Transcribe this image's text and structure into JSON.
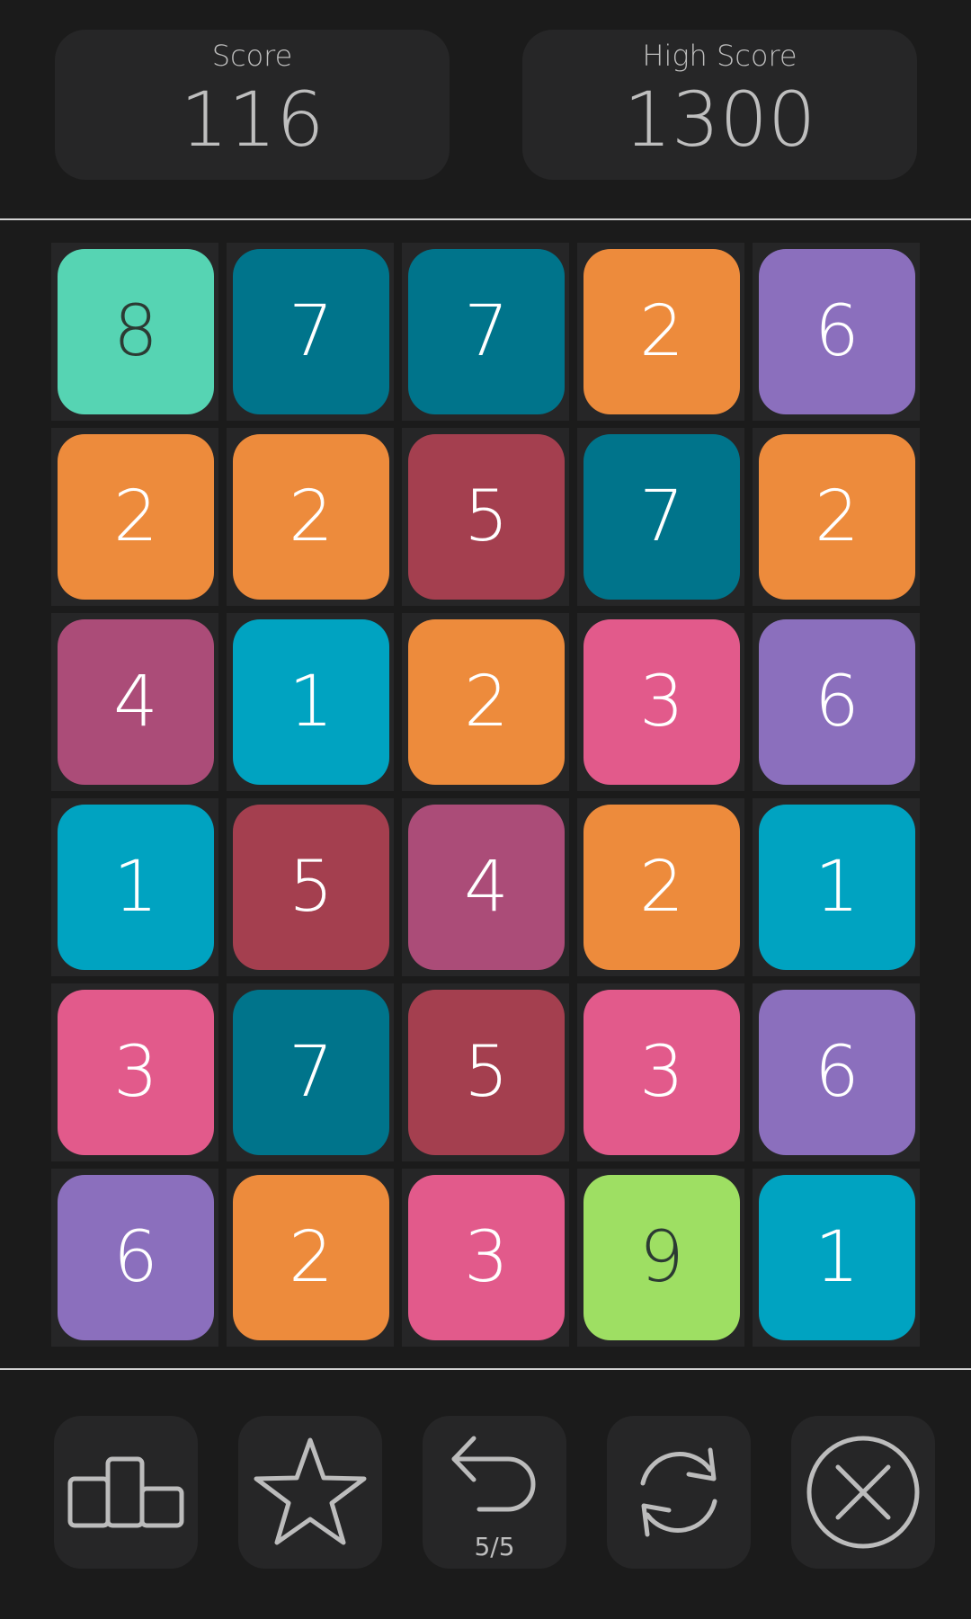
{
  "header": {
    "score_label": "Score",
    "score_value": "116",
    "high_score_label": "High Score",
    "high_score_value": "1300"
  },
  "board": {
    "rows": [
      [
        "8",
        "7",
        "7",
        "2",
        "6"
      ],
      [
        "2",
        "2",
        "5",
        "7",
        "2"
      ],
      [
        "4",
        "1",
        "2",
        "3",
        "6"
      ],
      [
        "1",
        "5",
        "4",
        "2",
        "1"
      ],
      [
        "3",
        "7",
        "5",
        "3",
        "6"
      ],
      [
        "6",
        "2",
        "3",
        "9",
        "1"
      ]
    ],
    "tile_colors": {
      "1": "#00a3c1",
      "2": "#ed8b3c",
      "3": "#e25a8b",
      "4": "#ab4c78",
      "5": "#a43f4f",
      "6": "#8b6fbd",
      "7": "#00748b",
      "8": "#56d4b3",
      "9": "#9edf63"
    },
    "dark_text_values": [
      "8",
      "9"
    ],
    "dark_text_color": "#2c3a33"
  },
  "toolbar": {
    "leaderboard_icon": "podium-icon",
    "star_icon": "star-icon",
    "undo_icon": "undo-icon",
    "undo_count": "5/5",
    "shuffle_icon": "shuffle-icon",
    "close_icon": "close-circle-icon"
  }
}
